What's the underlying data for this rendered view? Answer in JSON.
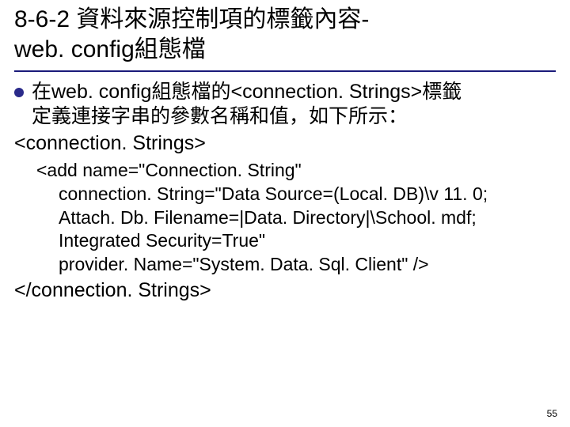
{
  "title_line1": "8-6-2 資料來源控制項的標籤內容-",
  "title_line2": "web. config組態檔",
  "bullet_text_line1": "在web. config組態檔的<connection. Strings>標籤",
  "bullet_text_line2": "定義連接字串的參數名稱和值，如下所示：",
  "tag_open": "<connection. Strings>",
  "code": {
    "l1": "<add name=\"Connection. String\"",
    "l2": "connection. String=\"Data Source=(Local. DB)\\v 11. 0;",
    "l3": "Attach. Db. Filename=|Data. Directory|\\School. mdf;",
    "l4": "Integrated Security=True\"",
    "l5": "provider. Name=\"System. Data. Sql. Client\" />"
  },
  "tag_close": "</connection. Strings>",
  "page_number": "55"
}
